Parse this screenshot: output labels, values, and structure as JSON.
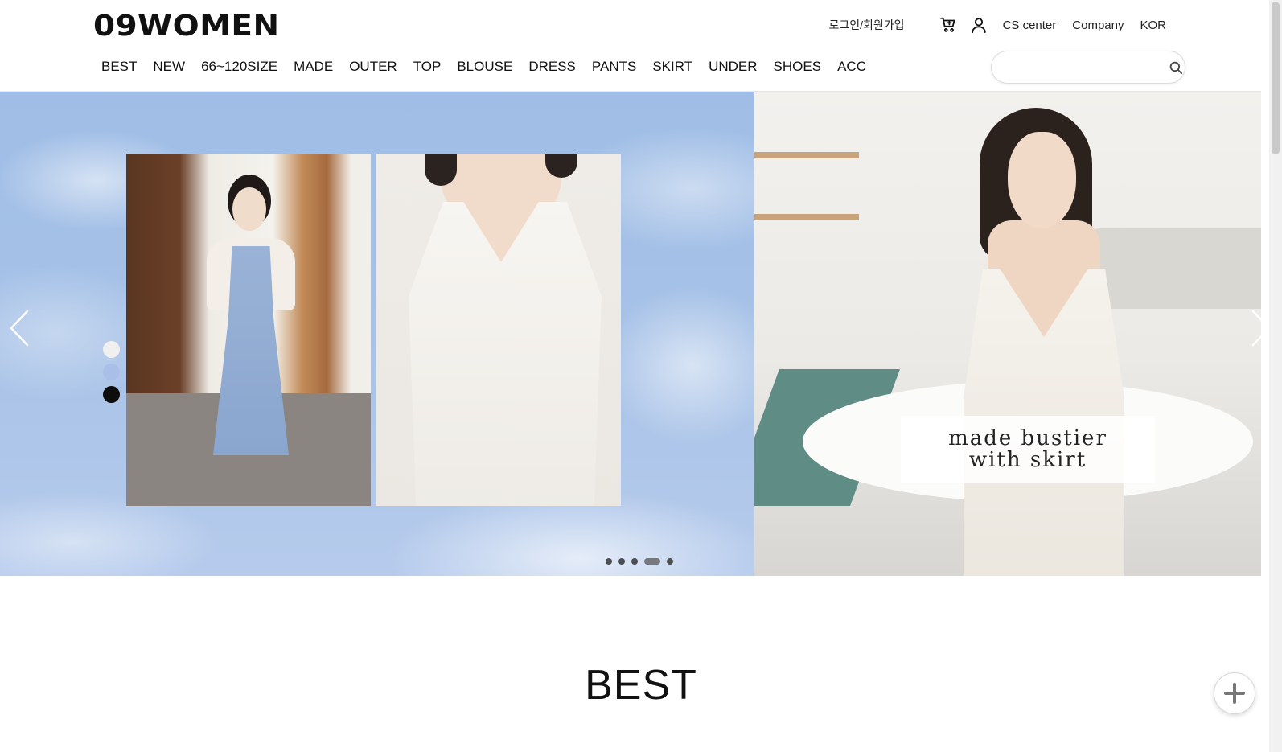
{
  "header": {
    "logo": "09WOMEN",
    "login_label": "로그인/회원가입",
    "cs_label": "CS center",
    "company_label": "Company",
    "lang_label": "KOR",
    "cart_icon": "cart-icon",
    "user_icon": "user-icon"
  },
  "nav": {
    "items": [
      "BEST",
      "NEW",
      "66~120SIZE",
      "MADE",
      "OUTER",
      "TOP",
      "BLOUSE",
      "DRESS",
      "PANTS",
      "SKIRT",
      "UNDER",
      "SHOES",
      "ACC"
    ]
  },
  "search": {
    "placeholder": "",
    "value": "",
    "icon": "search-icon"
  },
  "hero": {
    "caption_line1": "made bustier",
    "caption_line2": "with skirt",
    "color_swatches": [
      "#f0f0f0",
      "#a9bfe8",
      "#0d0d0d"
    ],
    "slide_count": 5,
    "active_slide": 4,
    "prev_icon": "chevron-left-icon",
    "next_icon": "chevron-right-icon"
  },
  "best": {
    "title": "BEST"
  },
  "floating": {
    "plus_icon": "plus-icon"
  }
}
